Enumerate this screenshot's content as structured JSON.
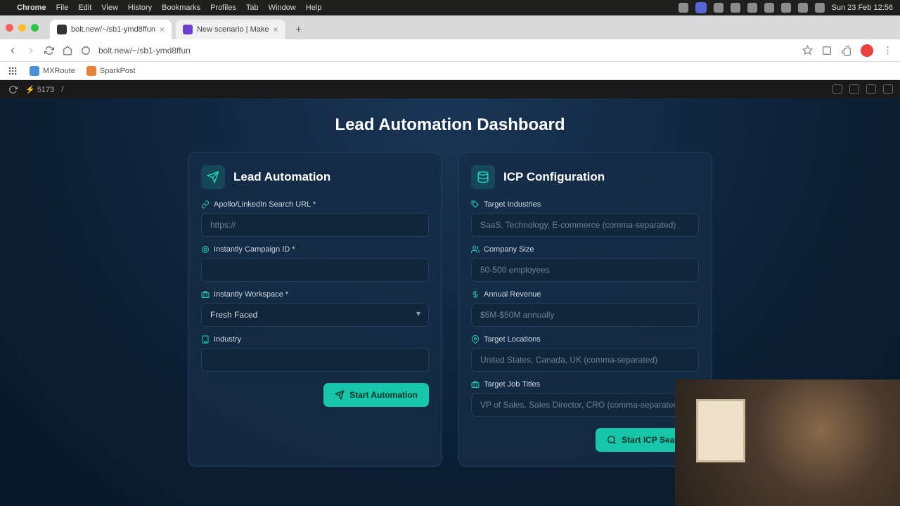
{
  "menubar": {
    "app": "Chrome",
    "items": [
      "File",
      "Edit",
      "View",
      "History",
      "Bookmarks",
      "Profiles",
      "Tab",
      "Window",
      "Help"
    ],
    "clock": "Sun 23 Feb  12:56"
  },
  "tabs": {
    "t1": "bolt.new/~/sb1-ymd8ffun",
    "t2": "New scenario | Make"
  },
  "address": {
    "url": "bolt.new/~/sb1-ymd8ffun"
  },
  "bookmarks": {
    "b1": "MXRoute",
    "b2": "SparkPost"
  },
  "pagebar": {
    "port": "5173",
    "path": "/"
  },
  "app": {
    "title": "Lead Automation Dashboard",
    "leadCard": {
      "title": "Lead Automation",
      "f1": {
        "label": "Apollo/LinkedIn Search URL *",
        "placeholder": "https://"
      },
      "f2": {
        "label": "Instantly Campaign ID *"
      },
      "f3": {
        "label": "Instantly Workspace *",
        "value": "Fresh Faced"
      },
      "f4": {
        "label": "Industry"
      },
      "button": "Start Automation"
    },
    "icpCard": {
      "title": "ICP Configuration",
      "f1": {
        "label": "Target Industries",
        "placeholder": "SaaS, Technology, E-commerce (comma-separated)"
      },
      "f2": {
        "label": "Company Size",
        "placeholder": "50-500 employees"
      },
      "f3": {
        "label": "Annual Revenue",
        "placeholder": "$5M-$50M annually"
      },
      "f4": {
        "label": "Target Locations",
        "placeholder": "United States, Canada, UK (comma-separated)"
      },
      "f5": {
        "label": "Target Job Titles",
        "placeholder": "VP of Sales, Sales Director, CRO (comma-separated)"
      },
      "button": "Start ICP Search"
    }
  }
}
